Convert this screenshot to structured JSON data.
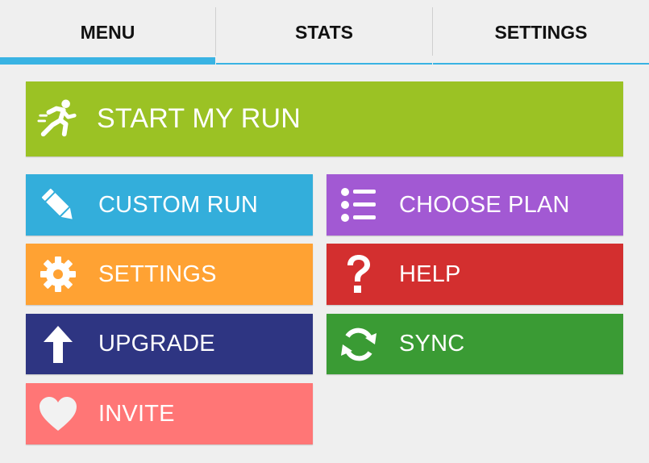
{
  "tabs": [
    {
      "label": "MENU",
      "active": true
    },
    {
      "label": "STATS",
      "active": false
    },
    {
      "label": "SETTINGS",
      "active": false
    }
  ],
  "menu": {
    "start_run": {
      "label": "START MY RUN",
      "color": "#9bc224",
      "icon": "runner-icon"
    },
    "custom_run": {
      "label": "CUSTOM RUN",
      "color": "#33aedb",
      "icon": "pencil-icon"
    },
    "choose_plan": {
      "label": "CHOOSE PLAN",
      "color": "#a259d3",
      "icon": "list-icon"
    },
    "settings": {
      "label": "SETTINGS",
      "color": "#ffa233",
      "icon": "gear-icon"
    },
    "help": {
      "label": "HELP",
      "color": "#d32f2f",
      "icon": "question-icon"
    },
    "upgrade": {
      "label": "UPGRADE",
      "color": "#2e3582",
      "icon": "arrow-up-icon"
    },
    "sync": {
      "label": "SYNC",
      "color": "#3a9b34",
      "icon": "sync-icon"
    },
    "invite": {
      "label": "INVITE",
      "color": "#ff7676",
      "icon": "heart-icon"
    }
  }
}
